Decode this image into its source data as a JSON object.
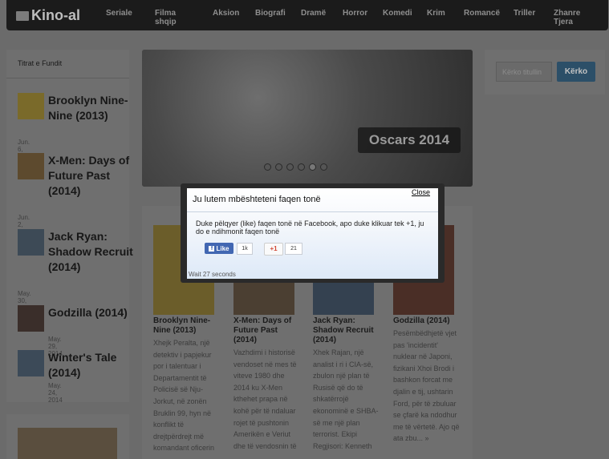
{
  "site": {
    "logo_text": "Kino-al"
  },
  "nav": [
    "Seriale",
    "Filma shqip",
    "Aksion",
    "Biografi",
    "Dramë",
    "Horror",
    "Komedi",
    "Krim",
    "Romancë",
    "Triller",
    "Zhanre Tjera"
  ],
  "sidebar": {
    "title": "Titrat e Fundit",
    "posts": [
      {
        "title": "Brooklyn Nine-Nine (2013)",
        "date": "Jun. 6, 2014"
      },
      {
        "title": "X-Men: Days of Future Past (2014)",
        "date": "Jun. 2, 2014"
      },
      {
        "title": "Jack Ryan: Shadow Recruit (2014)",
        "date": "May. 30, 2014"
      },
      {
        "title": "Godzilla (2014)",
        "date": "May. 29, 2014"
      },
      {
        "title": "Winter's Tale (2014)",
        "date": "May. 24, 2014"
      }
    ]
  },
  "slider": {
    "caption": "Oscars 2014",
    "dots": 6,
    "active_dot": 4
  },
  "search": {
    "placeholder": "Kërko titullin",
    "button": "Kërko"
  },
  "movies": [
    {
      "title": "Brooklyn Nine-Nine (2013)",
      "excerpt": "Xhejk Peralta, një detektiv i papjekur por i talentuar i Departamentit të Policisë së Nju-Jorkut, në zonën Bruklin 99, hyn në konflikt të drejtpërdrejt më komandant oficerin"
    },
    {
      "title": "X-Men: Days of Future Past (2014)",
      "excerpt": "Vazhdimi i historisë vendoset në mes të viteve 1980 dhe 2014 ku X-Men kthehet prapa në kohë për të ndaluar rojet të pushtonin Amerikën e Veriut dhe të vendosnin të"
    },
    {
      "title": "Jack Ryan: Shadow Recruit (2014)",
      "excerpt": "Xhek Rajan, një analist i ri i CIA-së, zbulon një plan të Rusisë që do të shkatërrojë ekonominë e SHBA-së me një plan terrorist. Ekipi Regjisori: Kenneth"
    },
    {
      "title": "Godzilla (2014)",
      "excerpt": "Pesëmbëdhjetë vjet pas 'incidentit' nuklear në Japoni, fizikani Xhoi Brodi i bashkon forcat me djalin e tij, ushtarin Ford, për të zbuluar se çfarë ka ndodhur me të vërtetë. Ajo që ata zbu... »"
    }
  ],
  "modal": {
    "title": "Ju lutem mbështeteni faqen tonë",
    "close": "Close",
    "text": "Duke pëlqyer (like) faqen tonë në Facebook, apo duke klikuar tek +1, ju do e ndihmonit faqen tonë",
    "fb_label": "Like",
    "fb_count": "1k",
    "gplus_label": "+1",
    "gplus_count": "21",
    "wait": "Wait 27 seconds"
  },
  "colors": {
    "accent": "#2c4f68",
    "facebook": "#4267b2",
    "gplus": "#d14836"
  }
}
